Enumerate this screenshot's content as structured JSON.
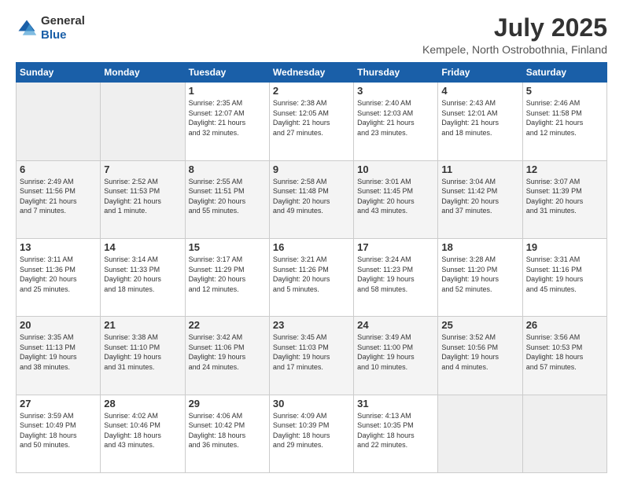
{
  "header": {
    "logo_line1": "General",
    "logo_line2": "Blue",
    "month_title": "July 2025",
    "subtitle": "Kempele, North Ostrobothnia, Finland"
  },
  "weekdays": [
    "Sunday",
    "Monday",
    "Tuesday",
    "Wednesday",
    "Thursday",
    "Friday",
    "Saturday"
  ],
  "weeks": [
    [
      {
        "day": "",
        "info": ""
      },
      {
        "day": "",
        "info": ""
      },
      {
        "day": "1",
        "info": "Sunrise: 2:35 AM\nSunset: 12:07 AM\nDaylight: 21 hours\nand 32 minutes."
      },
      {
        "day": "2",
        "info": "Sunrise: 2:38 AM\nSunset: 12:05 AM\nDaylight: 21 hours\nand 27 minutes."
      },
      {
        "day": "3",
        "info": "Sunrise: 2:40 AM\nSunset: 12:03 AM\nDaylight: 21 hours\nand 23 minutes."
      },
      {
        "day": "4",
        "info": "Sunrise: 2:43 AM\nSunset: 12:01 AM\nDaylight: 21 hours\nand 18 minutes."
      },
      {
        "day": "5",
        "info": "Sunrise: 2:46 AM\nSunset: 11:58 PM\nDaylight: 21 hours\nand 12 minutes."
      }
    ],
    [
      {
        "day": "6",
        "info": "Sunrise: 2:49 AM\nSunset: 11:56 PM\nDaylight: 21 hours\nand 7 minutes."
      },
      {
        "day": "7",
        "info": "Sunrise: 2:52 AM\nSunset: 11:53 PM\nDaylight: 21 hours\nand 1 minute."
      },
      {
        "day": "8",
        "info": "Sunrise: 2:55 AM\nSunset: 11:51 PM\nDaylight: 20 hours\nand 55 minutes."
      },
      {
        "day": "9",
        "info": "Sunrise: 2:58 AM\nSunset: 11:48 PM\nDaylight: 20 hours\nand 49 minutes."
      },
      {
        "day": "10",
        "info": "Sunrise: 3:01 AM\nSunset: 11:45 PM\nDaylight: 20 hours\nand 43 minutes."
      },
      {
        "day": "11",
        "info": "Sunrise: 3:04 AM\nSunset: 11:42 PM\nDaylight: 20 hours\nand 37 minutes."
      },
      {
        "day": "12",
        "info": "Sunrise: 3:07 AM\nSunset: 11:39 PM\nDaylight: 20 hours\nand 31 minutes."
      }
    ],
    [
      {
        "day": "13",
        "info": "Sunrise: 3:11 AM\nSunset: 11:36 PM\nDaylight: 20 hours\nand 25 minutes."
      },
      {
        "day": "14",
        "info": "Sunrise: 3:14 AM\nSunset: 11:33 PM\nDaylight: 20 hours\nand 18 minutes."
      },
      {
        "day": "15",
        "info": "Sunrise: 3:17 AM\nSunset: 11:29 PM\nDaylight: 20 hours\nand 12 minutes."
      },
      {
        "day": "16",
        "info": "Sunrise: 3:21 AM\nSunset: 11:26 PM\nDaylight: 20 hours\nand 5 minutes."
      },
      {
        "day": "17",
        "info": "Sunrise: 3:24 AM\nSunset: 11:23 PM\nDaylight: 19 hours\nand 58 minutes."
      },
      {
        "day": "18",
        "info": "Sunrise: 3:28 AM\nSunset: 11:20 PM\nDaylight: 19 hours\nand 52 minutes."
      },
      {
        "day": "19",
        "info": "Sunrise: 3:31 AM\nSunset: 11:16 PM\nDaylight: 19 hours\nand 45 minutes."
      }
    ],
    [
      {
        "day": "20",
        "info": "Sunrise: 3:35 AM\nSunset: 11:13 PM\nDaylight: 19 hours\nand 38 minutes."
      },
      {
        "day": "21",
        "info": "Sunrise: 3:38 AM\nSunset: 11:10 PM\nDaylight: 19 hours\nand 31 minutes."
      },
      {
        "day": "22",
        "info": "Sunrise: 3:42 AM\nSunset: 11:06 PM\nDaylight: 19 hours\nand 24 minutes."
      },
      {
        "day": "23",
        "info": "Sunrise: 3:45 AM\nSunset: 11:03 PM\nDaylight: 19 hours\nand 17 minutes."
      },
      {
        "day": "24",
        "info": "Sunrise: 3:49 AM\nSunset: 11:00 PM\nDaylight: 19 hours\nand 10 minutes."
      },
      {
        "day": "25",
        "info": "Sunrise: 3:52 AM\nSunset: 10:56 PM\nDaylight: 19 hours\nand 4 minutes."
      },
      {
        "day": "26",
        "info": "Sunrise: 3:56 AM\nSunset: 10:53 PM\nDaylight: 18 hours\nand 57 minutes."
      }
    ],
    [
      {
        "day": "27",
        "info": "Sunrise: 3:59 AM\nSunset: 10:49 PM\nDaylight: 18 hours\nand 50 minutes."
      },
      {
        "day": "28",
        "info": "Sunrise: 4:02 AM\nSunset: 10:46 PM\nDaylight: 18 hours\nand 43 minutes."
      },
      {
        "day": "29",
        "info": "Sunrise: 4:06 AM\nSunset: 10:42 PM\nDaylight: 18 hours\nand 36 minutes."
      },
      {
        "day": "30",
        "info": "Sunrise: 4:09 AM\nSunset: 10:39 PM\nDaylight: 18 hours\nand 29 minutes."
      },
      {
        "day": "31",
        "info": "Sunrise: 4:13 AM\nSunset: 10:35 PM\nDaylight: 18 hours\nand 22 minutes."
      },
      {
        "day": "",
        "info": ""
      },
      {
        "day": "",
        "info": ""
      }
    ]
  ]
}
